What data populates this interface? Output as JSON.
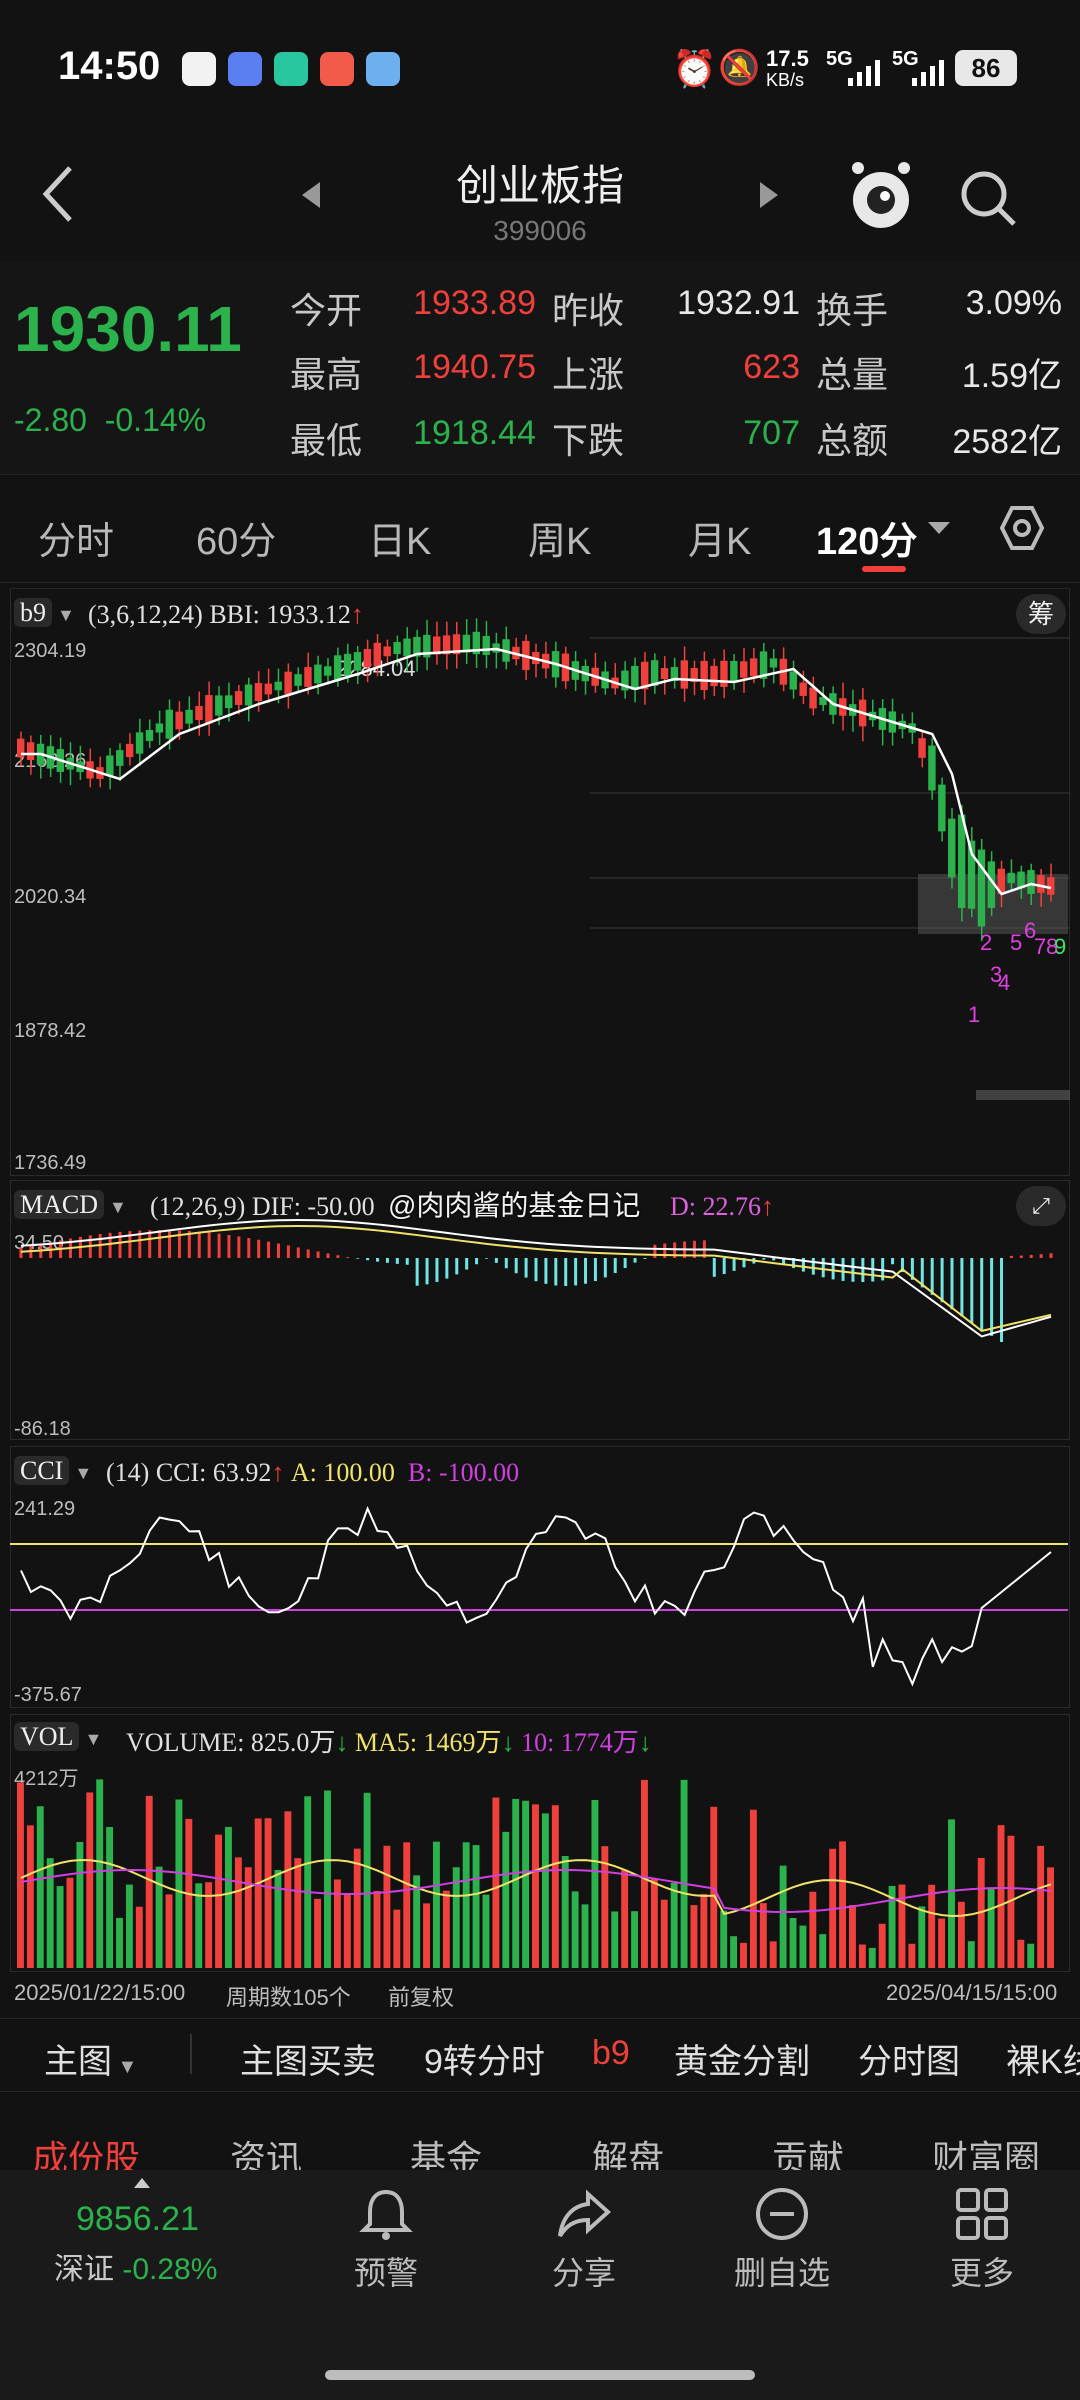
{
  "status_bar": {
    "time": "14:50",
    "net_speed": "17.5",
    "net_unit": "KB/s",
    "signal1": "5G",
    "signal2": "5G",
    "battery": "86"
  },
  "header": {
    "title": "创业板指",
    "code": "399006"
  },
  "quote": {
    "price": "1930.11",
    "change": "-2.80",
    "change_pct": "-0.14%",
    "rows": [
      {
        "l1": "今开",
        "v1": "1933.89",
        "c1": "red",
        "l2": "昨收",
        "v2": "1932.91",
        "c2": "white",
        "l3": "换手",
        "v3": "3.09%",
        "c3": "white"
      },
      {
        "l1": "最高",
        "v1": "1940.75",
        "c1": "red",
        "l2": "上涨",
        "v2": "623",
        "c2": "red",
        "l3": "总量",
        "v3": "1.59亿",
        "c3": "white"
      },
      {
        "l1": "最低",
        "v1": "1918.44",
        "c1": "green",
        "l2": "下跌",
        "v2": "707",
        "c2": "green",
        "l3": "总额",
        "v3": "2582亿",
        "c3": "white"
      }
    ]
  },
  "tabs": [
    "分时",
    "60分",
    "日K",
    "周K",
    "月K",
    "120分"
  ],
  "active_tab": "120分",
  "main_chart": {
    "indicator": "b9",
    "params": "(3,6,12,24) BBI: 1933.12",
    "arrow": "↑",
    "chip_btn": "筹",
    "y_labels": [
      "2304.19",
      "2162.26",
      "2020.34",
      "1878.42",
      "1736.49"
    ],
    "peak_label": "2284.04",
    "td_numbers": [
      "1",
      "2",
      "3",
      "4",
      "5",
      "6",
      "7",
      "8",
      "9"
    ]
  },
  "macd": {
    "name": "MACD",
    "params": "(12,26,9) DIF: -50.00",
    "dea_label": "D: 22.76",
    "arrow": "↑",
    "y_top": "34.50",
    "y_bottom": "-86.18"
  },
  "watermark": "@肉肉酱的基金日记",
  "cci": {
    "name": "CCI",
    "params": "(14) CCI: 63.92",
    "arrow": "↑",
    "a": "A: 100.00",
    "b": "B: -100.00",
    "y_top": "241.29",
    "y_bottom": "-375.67"
  },
  "vol": {
    "name": "VOL",
    "volume": "VOLUME: 825.0万",
    "ma5": "MA5: 1469万",
    "ma10": "10: 1774万",
    "y_top": "4212万",
    "date_start": "2025/01/22/15:00",
    "periods": "周期数105个",
    "adjust": "前复权",
    "date_end": "2025/04/15/15:00"
  },
  "bottom_bar": {
    "main": "主图",
    "items": [
      "主图买卖",
      "9转分时",
      "b9",
      "黄金分割",
      "分时图",
      "裸K线"
    ]
  },
  "sub_tabs": [
    "成份股",
    "资讯",
    "基金",
    "解盘",
    "贡献",
    "财富圈"
  ],
  "dock": {
    "index_value": "9856.21",
    "index_name": "深证",
    "index_change": "-0.28%",
    "items": [
      "预警",
      "分享",
      "删自选",
      "更多"
    ]
  },
  "colors": {
    "up": "#f0403c",
    "down": "#2bb24c",
    "bbi": "#ffffff",
    "macd_dea": "#f0e26a",
    "cci_a": "#f0e26a",
    "cci_b": "#d040e0",
    "ma5": "#f0e26a",
    "ma10": "#d040e0",
    "hist_neg": "#6fe6e6"
  }
}
